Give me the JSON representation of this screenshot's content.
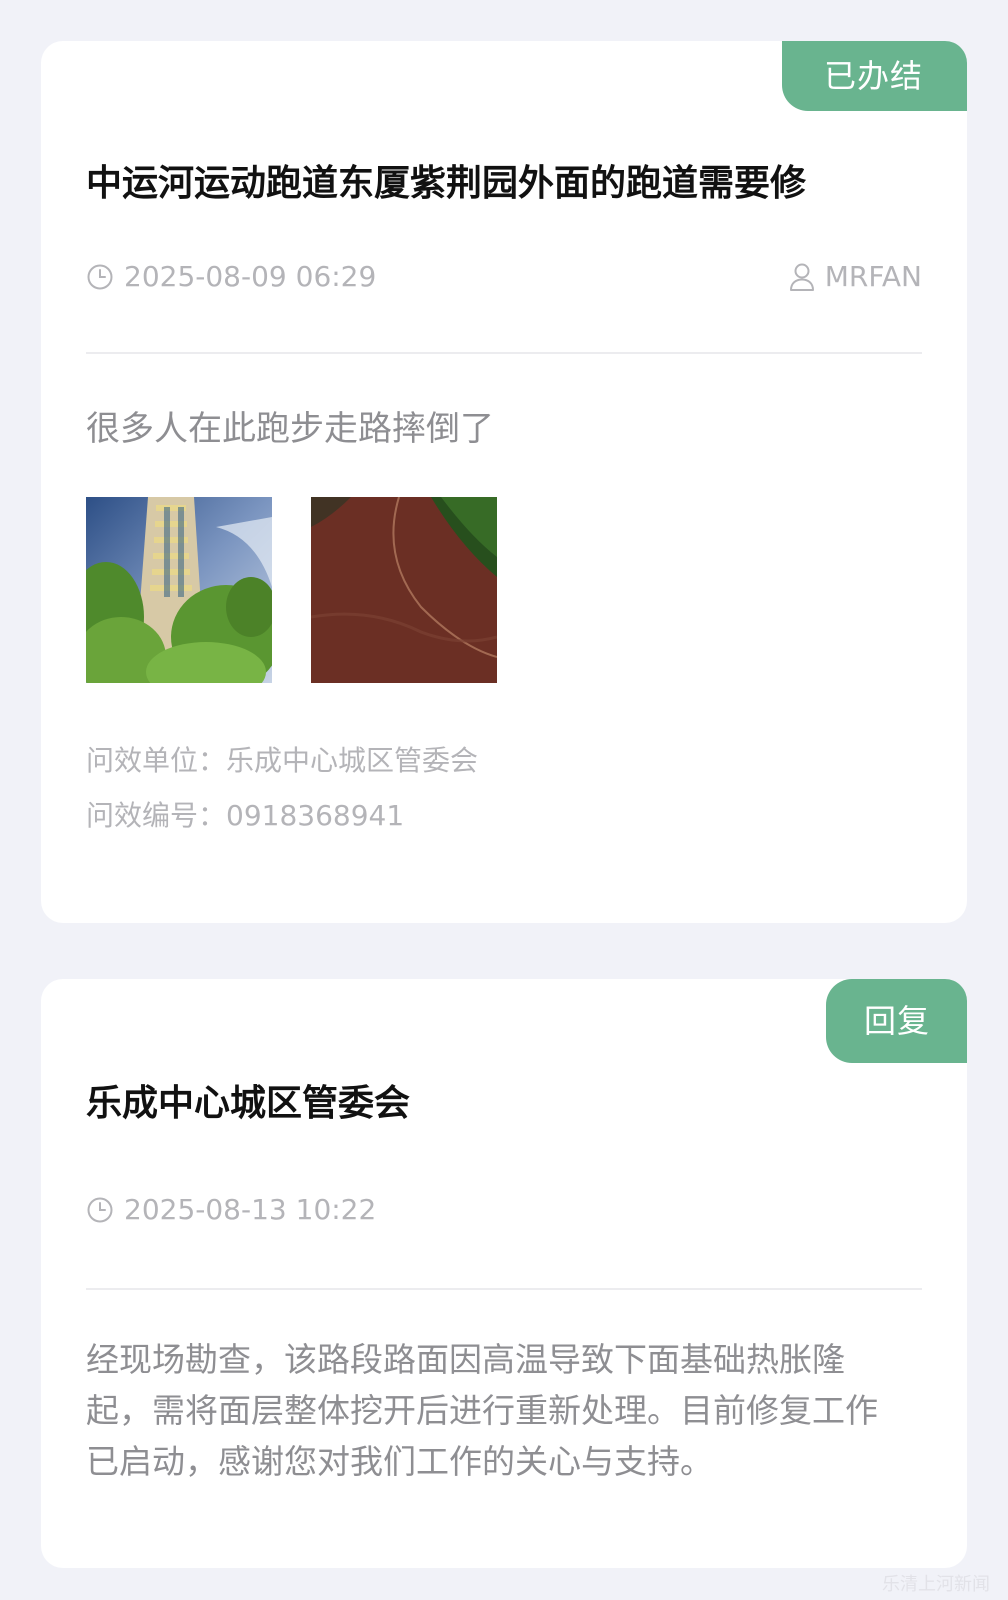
{
  "complaint": {
    "status": "已办结",
    "title": "中运河运动跑道东厦紫荆园外面的跑道需要修",
    "datetime": "2025-08-09 06:29",
    "user": "MRFAN",
    "description": "很多人在此跑步走路摔倒了",
    "images": [
      "building-photo",
      "running-track-photo"
    ],
    "unit_label": "问效单位：",
    "unit_value": "乐成中心城区管委会",
    "number_label": "问效编号：",
    "number_value": "0918368941"
  },
  "reply": {
    "status": "回复",
    "title": "乐成中心城区管委会",
    "datetime": "2025-08-13 10:22",
    "body": "经现场勘查，该路段路面因高温导致下面基础热胀隆起，需将面层整体挖开后进行重新处理。目前修复工作已启动，感谢您对我们工作的关心与支持。"
  },
  "watermark": "乐清上河新闻",
  "colors": {
    "accent": "#69b48f",
    "background": "#f1f2f8",
    "card": "#ffffff",
    "muted_text": "#b4b4b8"
  }
}
